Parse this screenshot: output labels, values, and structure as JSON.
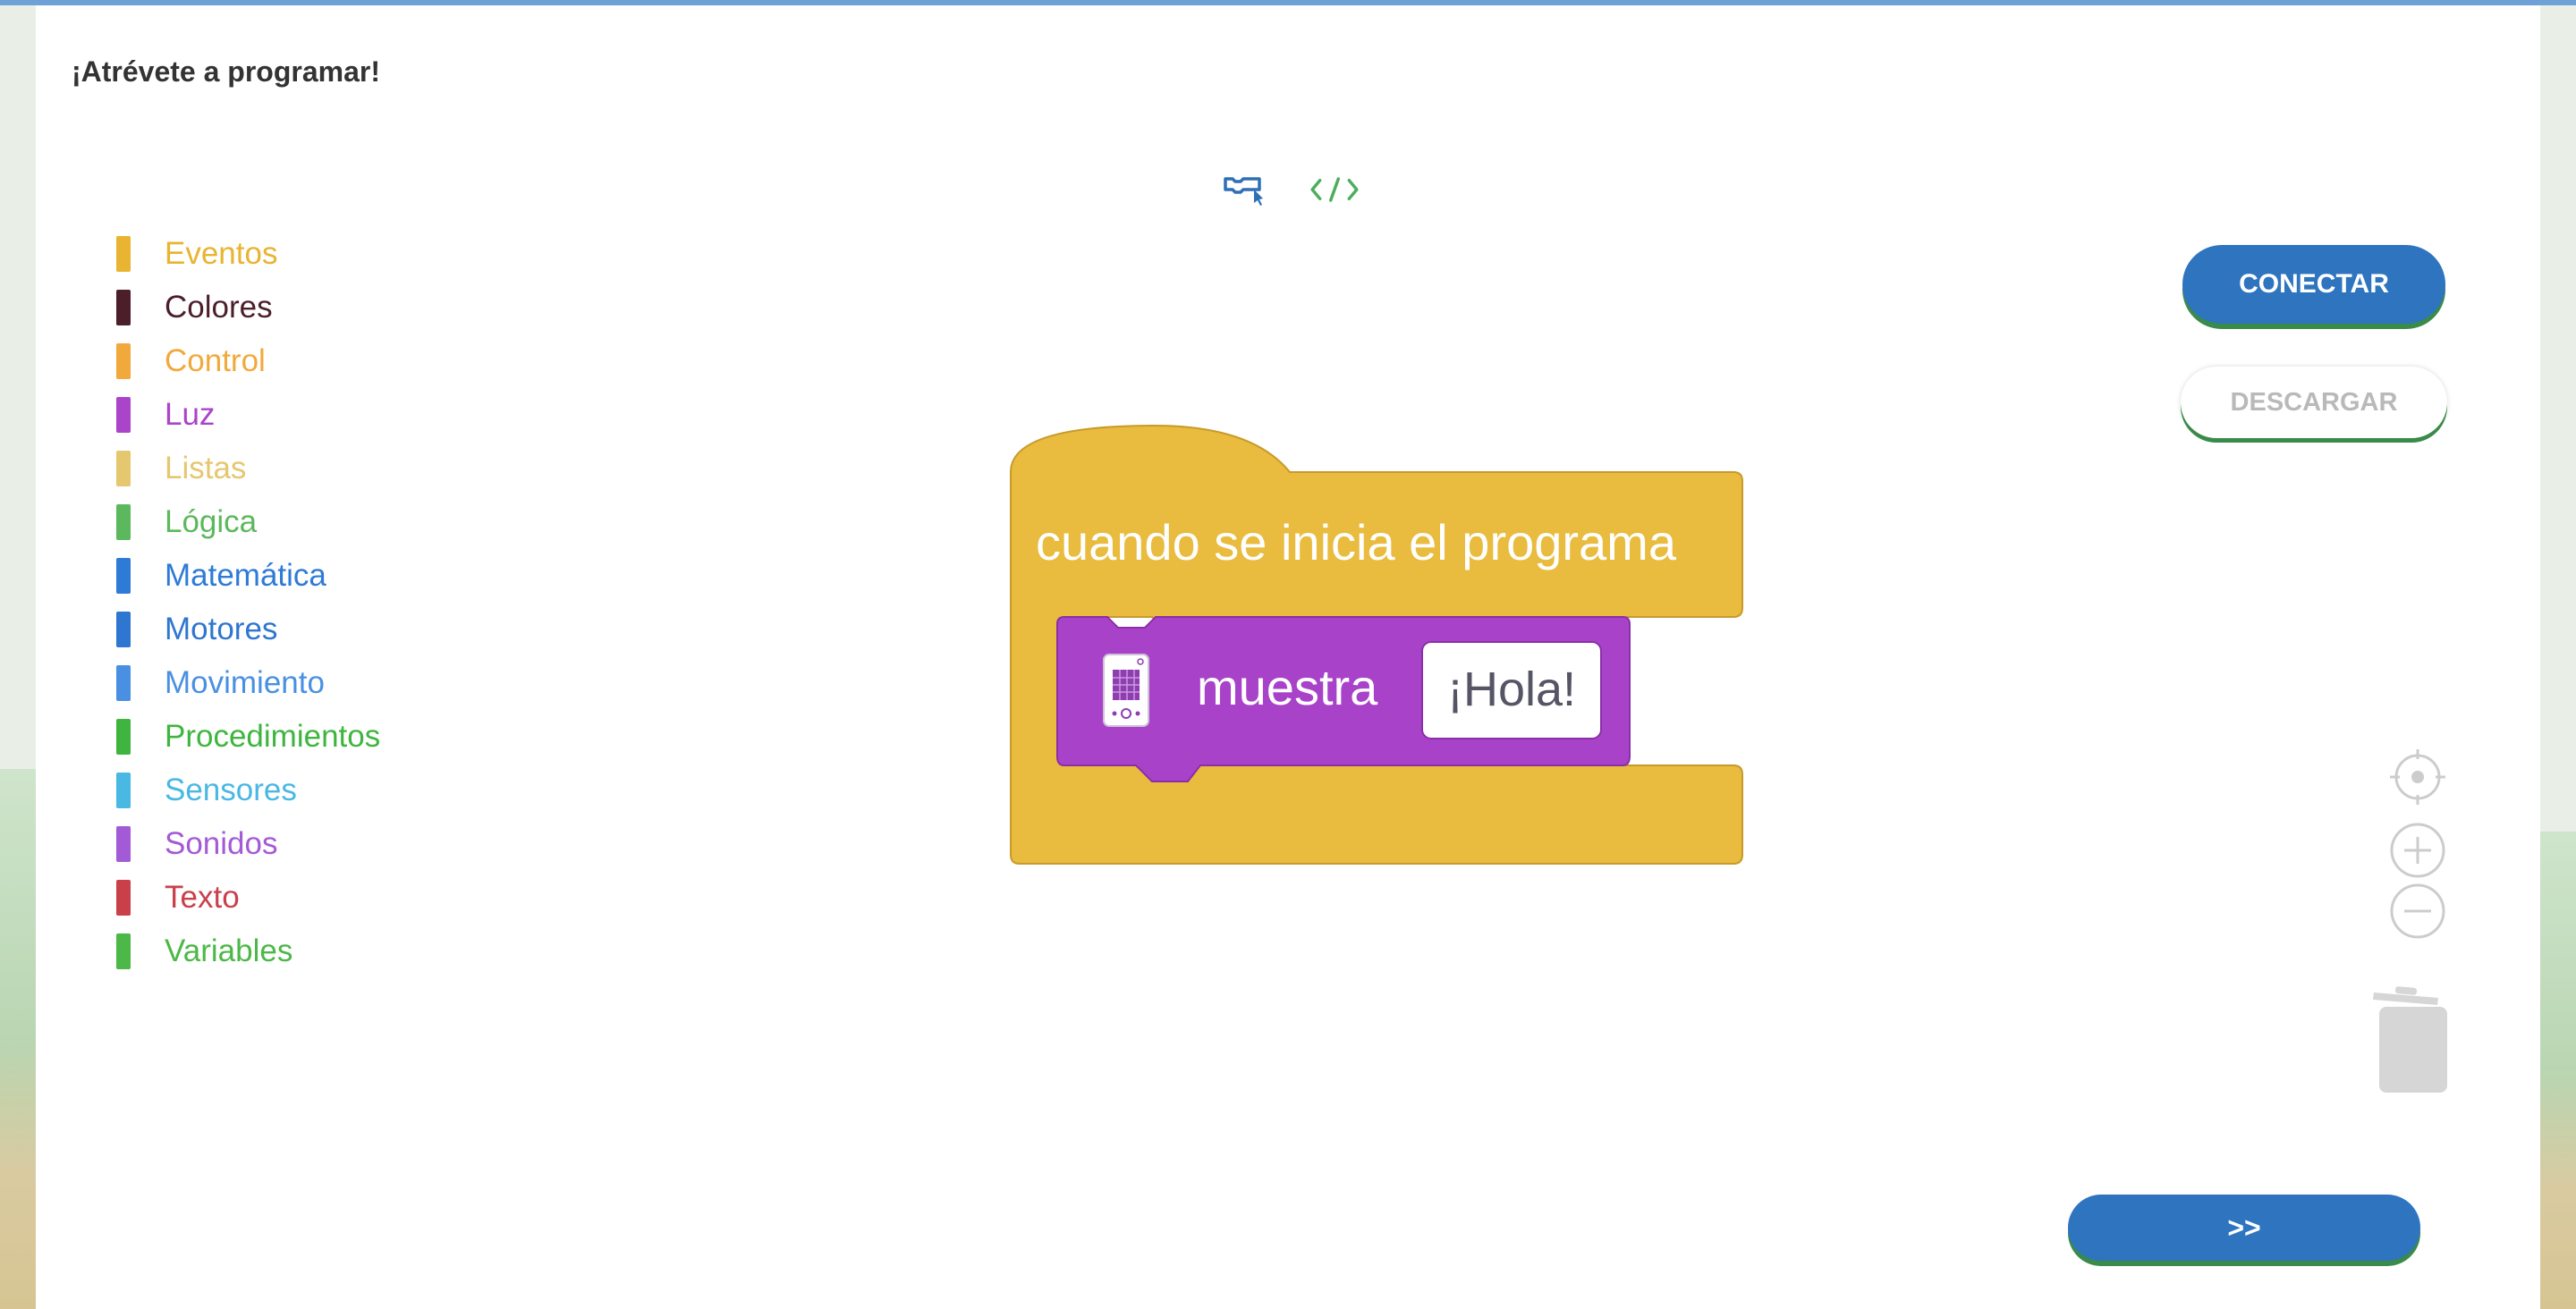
{
  "page": {
    "title": "¡Atrévete a programar!"
  },
  "categories": [
    {
      "label": "Eventos",
      "color": "#e8b431"
    },
    {
      "label": "Colores",
      "color": "#4b1e2a"
    },
    {
      "label": "Control",
      "color": "#f2a93b"
    },
    {
      "label": "Luz",
      "color": "#aa44c9"
    },
    {
      "label": "Listas",
      "color": "#e5c770"
    },
    {
      "label": "Lógica",
      "color": "#5cb85c"
    },
    {
      "label": "Matemática",
      "color": "#2e7bd6"
    },
    {
      "label": "Motores",
      "color": "#2e76cf"
    },
    {
      "label": "Movimiento",
      "color": "#4a90e2"
    },
    {
      "label": "Procedimientos",
      "color": "#3fb53f"
    },
    {
      "label": "Sensores",
      "color": "#49b8e3"
    },
    {
      "label": "Sonidos",
      "color": "#a35ad6"
    },
    {
      "label": "Texto",
      "color": "#c9404a"
    },
    {
      "label": "Variables",
      "color": "#4cb847"
    }
  ],
  "view_toggle": {
    "blocks_icon": "blocks-view-icon",
    "code_icon": "code-view-icon"
  },
  "actions": {
    "connect": "CONECTAR",
    "download": "DESCARGAR",
    "next": ">>"
  },
  "blocks": {
    "event_label": "cuando se inicia el programa",
    "event_color": "#e9bb3e",
    "show_label": "muestra",
    "show_color": "#a843c9",
    "show_value": "¡Hola!",
    "device_icon": "led-matrix-icon"
  },
  "workspace_tools": {
    "recenter": "target-icon",
    "zoom_in": "zoom-in-icon",
    "zoom_out": "zoom-out-icon",
    "trash": "trash-icon"
  }
}
